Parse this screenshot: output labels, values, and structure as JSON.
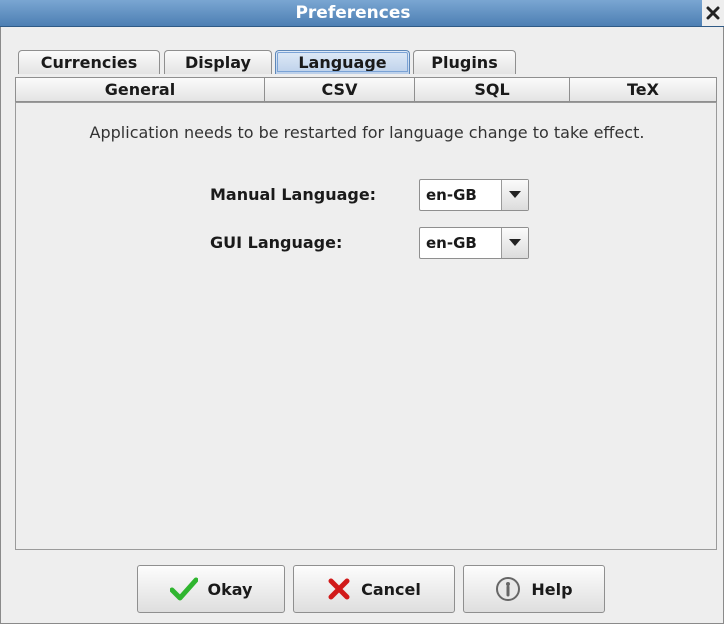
{
  "window": {
    "title": "Preferences"
  },
  "tabs_row1": [
    {
      "label": "Currencies",
      "selected": false
    },
    {
      "label": "Display",
      "selected": false
    },
    {
      "label": "Language",
      "selected": true
    },
    {
      "label": "Plugins",
      "selected": false
    }
  ],
  "tabs_row2": [
    {
      "label": "General"
    },
    {
      "label": "CSV"
    },
    {
      "label": "SQL"
    },
    {
      "label": "TeX"
    }
  ],
  "panel": {
    "notice": "Application needs to be restarted for language change to take effect.",
    "manual_language": {
      "label": "Manual Language:",
      "value": "en-GB"
    },
    "gui_language": {
      "label": "GUI Language:",
      "value": "en-GB"
    }
  },
  "buttons": {
    "okay": "Okay",
    "cancel": "Cancel",
    "help": "Help"
  },
  "icons": {
    "close": "close-icon",
    "okay": "checkmark-icon",
    "cancel": "x-mark-icon",
    "help": "info-icon",
    "dropdown": "chevron-down-icon"
  },
  "colors": {
    "titlebar": "#5b8cc0",
    "selected_tab": "#c8d9ee",
    "okay_icon": "#2fb52f",
    "cancel_icon": "#d11a1a"
  }
}
